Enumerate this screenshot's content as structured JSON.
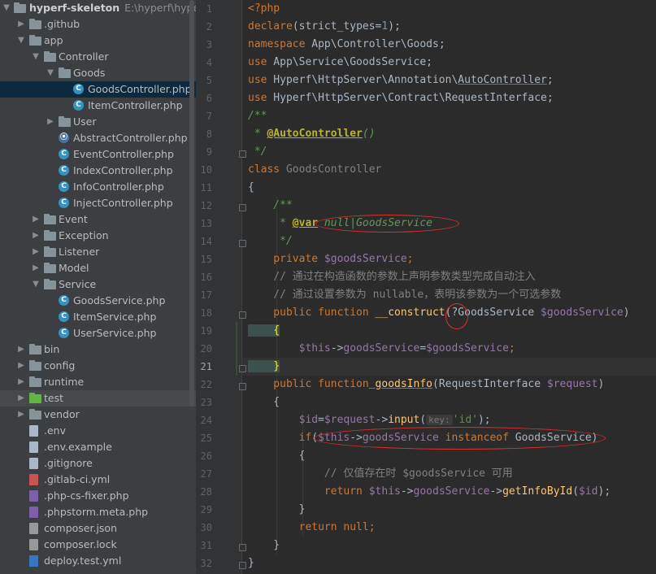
{
  "project_tree": {
    "root": {
      "name": "hyperf-skeleton",
      "path": "E:\\hyperf\\hyperf-s"
    },
    "items": [
      {
        "label": ".github",
        "type": "folder"
      },
      {
        "label": "app",
        "type": "folder"
      },
      {
        "label": "Controller",
        "type": "folder"
      },
      {
        "label": "Goods",
        "type": "folder"
      },
      {
        "label": "GoodsController.php",
        "type": "class"
      },
      {
        "label": "ItemController.php",
        "type": "class"
      },
      {
        "label": "User",
        "type": "folder"
      },
      {
        "label": "AbstractController.php",
        "type": "abstract-class"
      },
      {
        "label": "EventController.php",
        "type": "class"
      },
      {
        "label": "IndexController.php",
        "type": "class"
      },
      {
        "label": "InfoController.php",
        "type": "class"
      },
      {
        "label": "InjectController.php",
        "type": "class"
      },
      {
        "label": "Event",
        "type": "folder"
      },
      {
        "label": "Exception",
        "type": "folder"
      },
      {
        "label": "Listener",
        "type": "folder"
      },
      {
        "label": "Model",
        "type": "folder"
      },
      {
        "label": "Service",
        "type": "folder"
      },
      {
        "label": "GoodsService.php",
        "type": "class"
      },
      {
        "label": "ItemService.php",
        "type": "class"
      },
      {
        "label": "UserService.php",
        "type": "class"
      },
      {
        "label": "bin",
        "type": "folder"
      },
      {
        "label": "config",
        "type": "folder"
      },
      {
        "label": "runtime",
        "type": "folder"
      },
      {
        "label": "test",
        "type": "folder-test"
      },
      {
        "label": "vendor",
        "type": "folder"
      },
      {
        "label": ".env",
        "type": "file"
      },
      {
        "label": ".env.example",
        "type": "file"
      },
      {
        "label": ".gitignore",
        "type": "file"
      },
      {
        "label": ".gitlab-ci.yml",
        "type": "yml"
      },
      {
        "label": ".php-cs-fixer.php",
        "type": "php"
      },
      {
        "label": ".phpstorm.meta.php",
        "type": "php"
      },
      {
        "label": "composer.json",
        "type": "json"
      },
      {
        "label": "composer.lock",
        "type": "json"
      },
      {
        "label": "deploy.test.yml",
        "type": "dc"
      }
    ],
    "selected": "GoodsController.php"
  },
  "editor": {
    "current_line": "21",
    "line_numbers": [
      "1",
      "2",
      "3",
      "4",
      "5",
      "6",
      "7",
      "8",
      "9",
      "10",
      "11",
      "12",
      "13",
      "14",
      "15",
      "16",
      "17",
      "18",
      "19",
      "20",
      "21",
      "22",
      "23",
      "24",
      "25",
      "26",
      "27",
      "28",
      "29",
      "30",
      "31",
      "32"
    ],
    "param_hint": "key:",
    "code": {
      "l1": "<?php",
      "l2a": "declare",
      "l2b": "(strict_types=",
      "l2c": "1",
      "l2d": ");",
      "l3a": "namespace",
      "l3b": " App\\Controller\\Goods;",
      "l4a": "use",
      "l4b": " App\\Service\\GoodsService;",
      "l5a": "use",
      "l5b": " Hyperf\\HttpServer\\Annotation\\",
      "l5c": "AutoController",
      "l5d": ";",
      "l6a": "use",
      "l6b": " Hyperf\\HttpServer\\Contract\\RequestInterface;",
      "l7": "/**",
      "l8a": " * ",
      "l8b": "@AutoController",
      "l8c": "()",
      "l9": " */",
      "l10a": "class",
      "l10b": " GoodsController",
      "l11": "{",
      "l12": "    /**",
      "l13a": "     * ",
      "l13b": "@var",
      "l13c": " null|GoodsService",
      "l14": "     */",
      "l15a": "    private",
      "l15b": " $goodsService",
      "l15c": ";",
      "l16": "    // 通过在构造函数的参数上声明参数类型完成自动注入",
      "l17": "    // 通过设置参数为 nullable，表明该参数为一个可选参数",
      "l18a": "    public function",
      "l18b": " __construct",
      "l18c": "(?GoodsService ",
      "l18d": "$goodsService",
      "l18e": ")",
      "l19": "    {",
      "l20a": "        $this",
      "l20b": "->",
      "l20c": "goodsService",
      "l20d": "=",
      "l20e": "$goodsService",
      "l20f": ";",
      "l21": "    }",
      "l22a": "    public function",
      "l22b": " goodsInfo",
      "l22c": "(RequestInterface ",
      "l22d": "$request",
      "l22e": ")",
      "l23": "    {",
      "l24a": "        $id",
      "l24b": "=",
      "l24c": "$request",
      "l24d": "->",
      "l24e": "input",
      "l24f": "(",
      "l24g": "'id'",
      "l24h": ");",
      "l25a": "        if",
      "l25b": "(",
      "l25c": "$this",
      "l25d": "->",
      "l25e": "goodsService",
      "l25f": " instanceof",
      "l25g": " GoodsService)",
      "l26": "        {",
      "l27": "            // 仅值存在时 $goodsService 可用",
      "l28a": "            return",
      "l28b": " $this",
      "l28c": "->",
      "l28d": "goodsService",
      "l28e": "->",
      "l28f": "getInfoById",
      "l28g": "(",
      "l28h": "$id",
      "l28i": ");",
      "l29": "        }",
      "l30a": "        return",
      "l30b": " null",
      "l30c": ";",
      "l31": "    }",
      "l32": "}"
    }
  }
}
